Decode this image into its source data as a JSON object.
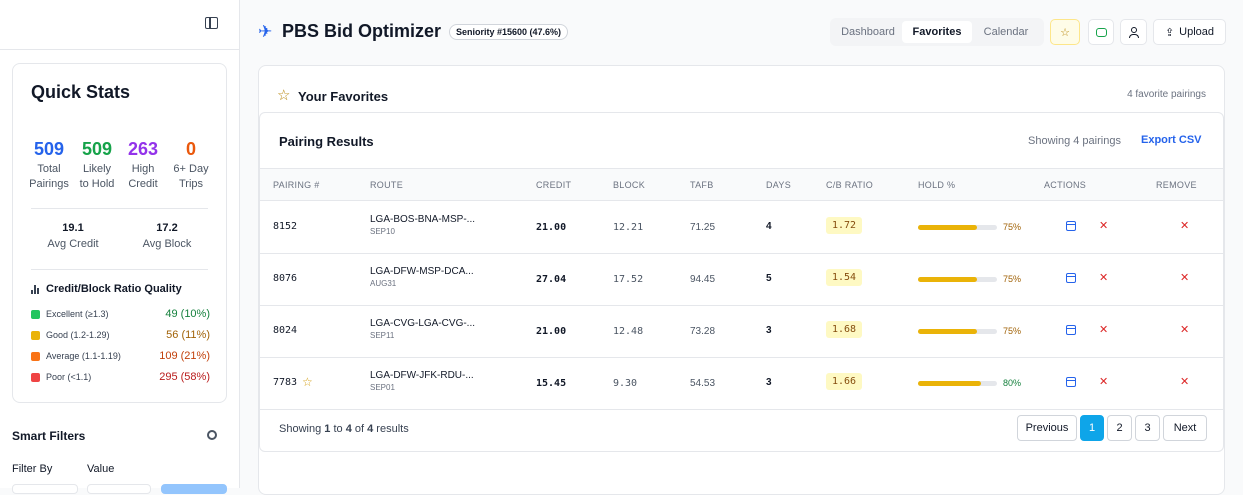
{
  "sidebar": {
    "quick_stats": {
      "title": "Quick Stats",
      "stats": [
        {
          "value": "509",
          "label1": "Total",
          "label2": "Pairings",
          "color": "#2563eb"
        },
        {
          "value": "509",
          "label1": "Likely",
          "label2": "to Hold",
          "color": "#16a34a"
        },
        {
          "value": "263",
          "label1": "High",
          "label2": "Credit",
          "color": "#9333ea"
        },
        {
          "value": "0",
          "label1": "6+ Day",
          "label2": "Trips",
          "color": "#ea580c"
        }
      ],
      "avg_credit_value": "19.1",
      "avg_credit_label": "Avg Credit",
      "avg_block_value": "17.2",
      "avg_block_label": "Avg Block",
      "ratio_title": "Credit/Block Ratio Quality",
      "quality": [
        {
          "label": "Excellent (≥1.3)",
          "value": "49 (10%)",
          "color": "#22c55e",
          "text_color": "#15803d"
        },
        {
          "label": "Good (1.2-1.29)",
          "value": "56 (11%)",
          "color": "#eab308",
          "text_color": "#a16207"
        },
        {
          "label": "Average (1.1-1.19)",
          "value": "109 (21%)",
          "color": "#f97316",
          "text_color": "#c2410c"
        },
        {
          "label": "Poor (<1.1)",
          "value": "295 (58%)",
          "color": "#ef4444",
          "text_color": "#b91c1c"
        }
      ]
    },
    "smart_filters": {
      "title": "Smart Filters",
      "filter_by_label": "Filter By",
      "value_label": "Value"
    }
  },
  "header": {
    "title": "PBS Bid Optimizer",
    "seniority": "Seniority #15600 (47.6%)",
    "tabs": [
      "Dashboard",
      "Favorites",
      "Calendar"
    ],
    "active_tab": "Favorites",
    "upload_label": "Upload"
  },
  "favorites": {
    "title": "Your Favorites",
    "count_text": "4 favorite pairings"
  },
  "results": {
    "title": "Pairing Results",
    "showing": "Showing 4 pairings",
    "export_label": "Export CSV",
    "columns": [
      "PAIRING #",
      "ROUTE",
      "CREDIT",
      "BLOCK",
      "TAFB",
      "DAYS",
      "C/B RATIO",
      "HOLD %",
      "ACTIONS",
      "REMOVE"
    ],
    "rows": [
      {
        "pairing": "8152",
        "route": "LGA-BOS-BNA-MSP-...",
        "date": "SEP10",
        "credit": "21.00",
        "block": "12.21",
        "tafb": "71.25",
        "days": "4",
        "cb": "1.72",
        "hold": "75%",
        "hold_value": 0.75,
        "hold_color": "#a16207",
        "starred": false
      },
      {
        "pairing": "8076",
        "route": "LGA-DFW-MSP-DCA...",
        "date": "AUG31",
        "credit": "27.04",
        "block": "17.52",
        "tafb": "94.45",
        "days": "5",
        "cb": "1.54",
        "hold": "75%",
        "hold_value": 0.75,
        "hold_color": "#a16207",
        "starred": false
      },
      {
        "pairing": "8024",
        "route": "LGA-CVG-LGA-CVG-...",
        "date": "SEP11",
        "credit": "21.00",
        "block": "12.48",
        "tafb": "73.28",
        "days": "3",
        "cb": "1.68",
        "hold": "75%",
        "hold_value": 0.75,
        "hold_color": "#a16207",
        "starred": false
      },
      {
        "pairing": "7783",
        "route": "LGA-DFW-JFK-RDU-...",
        "date": "SEP01",
        "credit": "15.45",
        "block": "9.30",
        "tafb": "54.53",
        "days": "3",
        "cb": "1.66",
        "hold": "80%",
        "hold_value": 0.8,
        "hold_color": "#15803d",
        "starred": true
      }
    ],
    "footer": {
      "prefix": "Showing ",
      "from": "1",
      "mid1": " to ",
      "to": "4",
      "mid2": " of ",
      "total": "4",
      "suffix": " results"
    },
    "pagination": {
      "previous": "Previous",
      "pages": [
        "1",
        "2",
        "3"
      ],
      "active": "1",
      "next": "Next"
    }
  }
}
